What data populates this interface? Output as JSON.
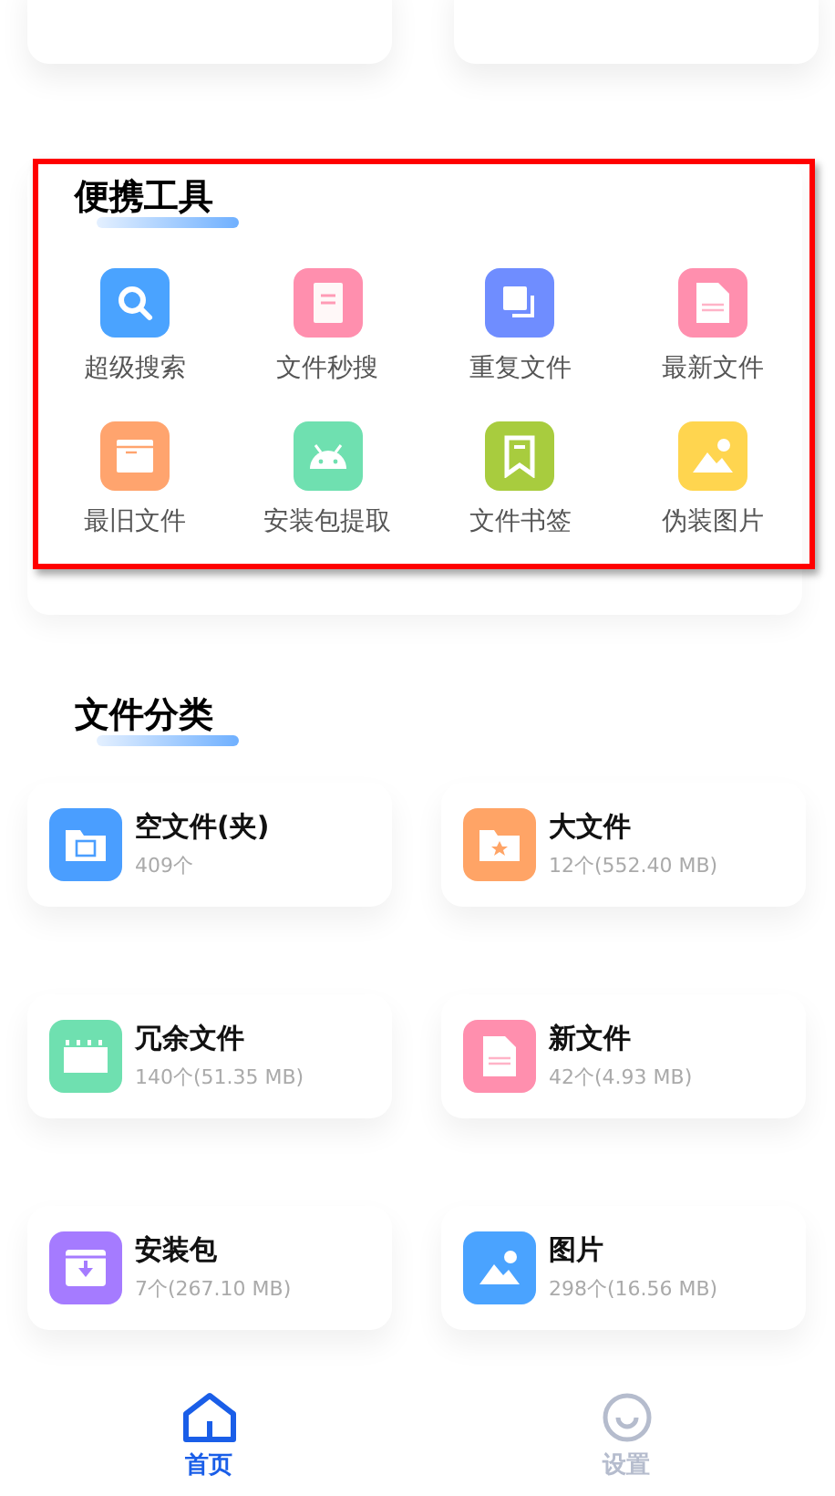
{
  "tools": {
    "title": "便携工具",
    "highlighted": true,
    "items": [
      {
        "label": "超级搜索",
        "kind": "search",
        "color": "#4aa3ff"
      },
      {
        "label": "文件秒搜",
        "kind": "doc",
        "color": "#ff8fae"
      },
      {
        "label": "重复文件",
        "kind": "copy",
        "color": "#6f8dff"
      },
      {
        "label": "最新文件",
        "kind": "new",
        "color": "#ff8fae"
      },
      {
        "label": "最旧文件",
        "kind": "box",
        "color": "#ffa46e"
      },
      {
        "label": "安装包提取",
        "kind": "android",
        "color": "#6fe0b0"
      },
      {
        "label": "文件书签",
        "kind": "bookmark",
        "color": "#a8cc3e"
      },
      {
        "label": "伪装图片",
        "kind": "image",
        "color": "#ffd54f"
      }
    ]
  },
  "categories": {
    "title": "文件分类",
    "items": [
      {
        "name": "空文件(夹)",
        "count": "409个",
        "kind": "folder-empty",
        "color": "#4a9eff"
      },
      {
        "name": "大文件",
        "count": "12个(552.40 MB)",
        "kind": "folder-star",
        "color": "#ffa466"
      },
      {
        "name": "冗余文件",
        "count": "140个(51.35 MB)",
        "kind": "clapper",
        "color": "#6fe0b0"
      },
      {
        "name": "新文件",
        "count": "42个(4.93 MB)",
        "kind": "new",
        "color": "#ff8fae"
      },
      {
        "name": "安装包",
        "count": "7个(267.10 MB)",
        "kind": "package",
        "color": "#a57bff"
      },
      {
        "name": "图片",
        "count": "298个(16.56 MB)",
        "kind": "image",
        "color": "#4aa3ff"
      }
    ]
  },
  "nav": [
    {
      "label": "首页",
      "kind": "home",
      "selected": true
    },
    {
      "label": "设置",
      "kind": "smile",
      "selected": false
    }
  ]
}
